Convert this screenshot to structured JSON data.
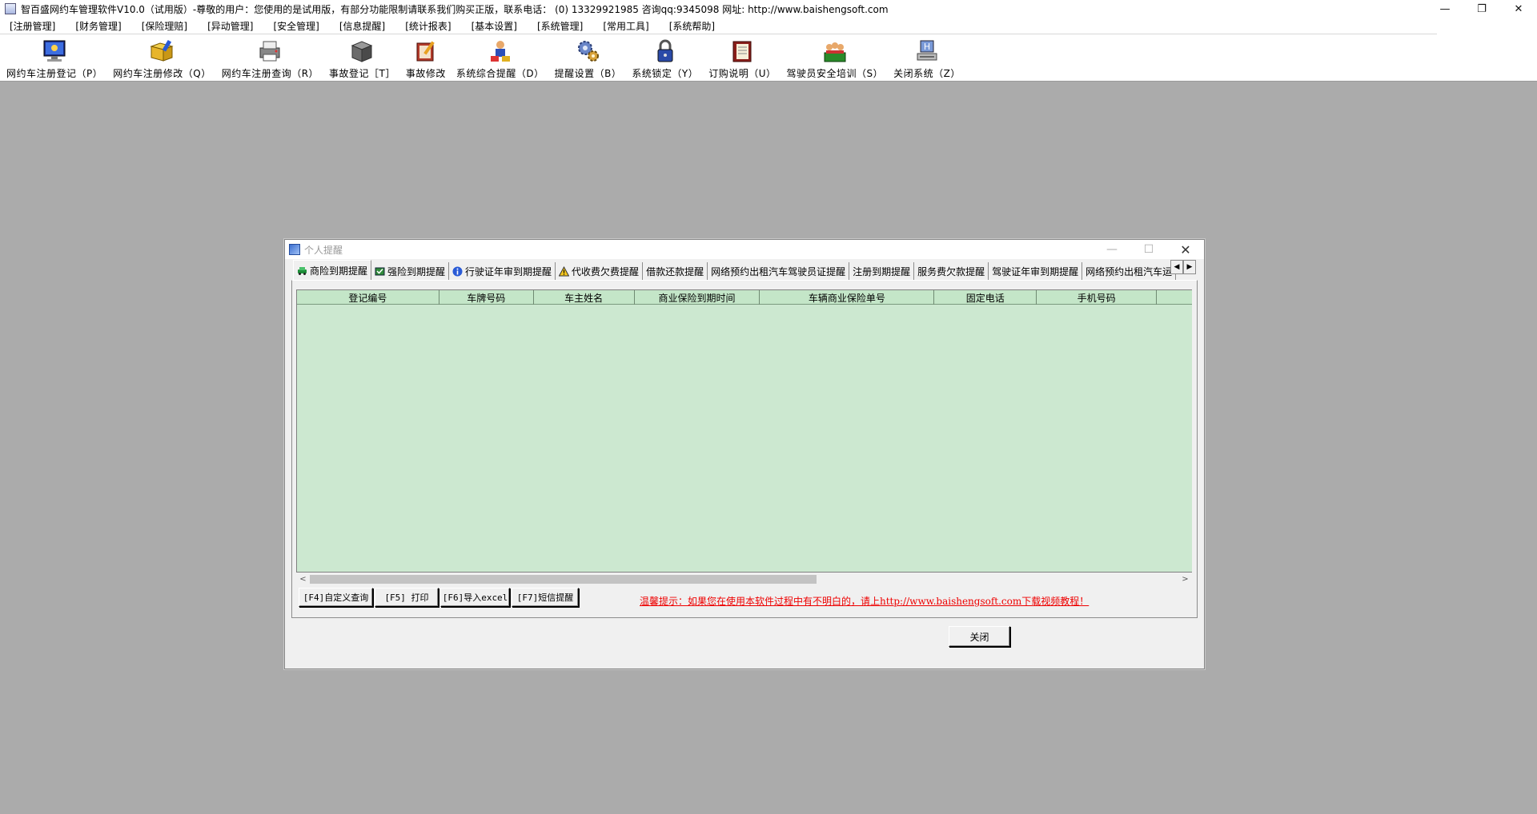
{
  "window": {
    "title": "智百盛网约车管理软件V10.0（试用版）-尊敬的用户：您使用的是试用版，有部分功能限制请联系我们购买正版，联系电话： (0) 13329921985  咨询qq:9345098    网址:   http://www.baishengsoft.com",
    "controls": {
      "minimize": "—",
      "restore": "❐",
      "close": "✕"
    }
  },
  "menu": {
    "items": [
      "[注册管理]",
      "[财务管理]",
      "[保险理赔]",
      "[异动管理]",
      "[安全管理]",
      "[信息提醒]",
      "[统计报表]",
      "[基本设置]",
      "[系统管理]",
      "[常用工具]",
      "[系统帮助]"
    ]
  },
  "toolbar": {
    "buttons": [
      {
        "label": "网约车注册登记（P）",
        "icon": "monitor-register-icon"
      },
      {
        "label": "网约车注册修改（Q）",
        "icon": "edit-folder-icon"
      },
      {
        "label": "网约车注册查询（R）",
        "icon": "query-printer-icon"
      },
      {
        "label": "事故登记［T］",
        "icon": "accident-box-icon"
      },
      {
        "label": "事故修改",
        "icon": "accident-edit-icon"
      },
      {
        "label": "系统综合提醒（D）",
        "icon": "reminder-people-icon"
      },
      {
        "label": "提醒设置（B）",
        "icon": "gear-settings-icon"
      },
      {
        "label": "系统锁定（Y）",
        "icon": "lock-icon"
      },
      {
        "label": "订购说明（U）",
        "icon": "book-icon"
      },
      {
        "label": "驾驶员安全培训（S）",
        "icon": "training-group-icon"
      },
      {
        "label": "关闭系统（Z）",
        "icon": "exit-computer-icon"
      }
    ]
  },
  "dialog": {
    "title": "个人提醒",
    "controls": {
      "minimize": "—",
      "maximize": "☐",
      "close": "✕"
    },
    "tabs": [
      {
        "label": "商险到期提醒",
        "active": true,
        "icon": "car-green-icon"
      },
      {
        "label": "强险到期提醒",
        "active": false,
        "icon": "car-check-icon"
      },
      {
        "label": "行驶证年审到期提醒",
        "active": false,
        "icon": "info-icon"
      },
      {
        "label": "代收费欠费提醒",
        "active": false,
        "icon": "warning-icon"
      },
      {
        "label": "借款还款提醒",
        "active": false,
        "icon": ""
      },
      {
        "label": "网络预约出租汽车驾驶员证提醒",
        "active": false,
        "icon": ""
      },
      {
        "label": "注册到期提醒",
        "active": false,
        "icon": ""
      },
      {
        "label": "服务费欠款提醒",
        "active": false,
        "icon": ""
      },
      {
        "label": "驾驶证年审到期提醒",
        "active": false,
        "icon": ""
      },
      {
        "label": "网络预约出租汽车运",
        "active": false,
        "icon": ""
      }
    ],
    "tab_scroll": {
      "left": "◀",
      "right": "▶"
    },
    "grid": {
      "columns": [
        "登记编号",
        "车牌号码",
        "车主姓名",
        "商业保险到期时间",
        "车辆商业保险单号",
        "固定电话",
        "手机号码",
        ""
      ],
      "rows": []
    },
    "scroll": {
      "left": "<",
      "right": ">"
    },
    "buttons": {
      "custom_query": "[F4]自定义查询",
      "print": "[F5] 打印",
      "export_excel": "[F6]导入excel",
      "sms": "[F7]短信提醒"
    },
    "tip": "温馨提示：如果您在使用本软件过程中有不明白的，请上http://www.baishengsoft.com下载视频教程！",
    "close_label": "关闭"
  }
}
